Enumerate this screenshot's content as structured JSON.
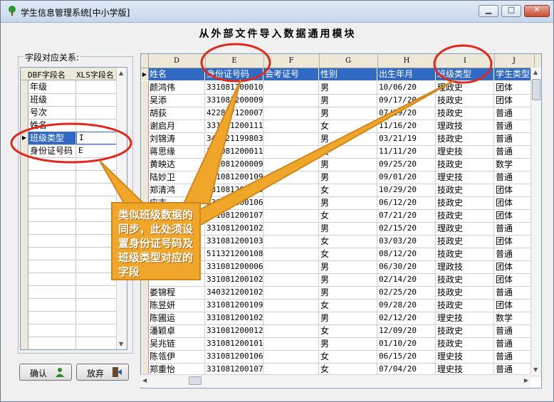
{
  "window": {
    "title": "学生信息管理系统[中小学版]",
    "controls": {
      "minimize": "▁",
      "maximize": "□",
      "close": "✕"
    }
  },
  "heading": "从外部文件导入数据通用模块",
  "mapping_group": {
    "label": "字段对应关系:",
    "columns": [
      "DBF字段名",
      "XLS字段名"
    ],
    "rows": [
      {
        "dbf": "年级",
        "xls": ""
      },
      {
        "dbf": "班级",
        "xls": ""
      },
      {
        "dbf": "号次",
        "xls": ""
      },
      {
        "dbf": "姓名",
        "xls": ""
      },
      {
        "dbf": "班级类型",
        "xls": "I",
        "selected": true
      },
      {
        "dbf": "身份证号码",
        "xls": "E"
      }
    ]
  },
  "buttons": {
    "confirm": "确认",
    "cancel": "放弃"
  },
  "grid": {
    "column_letters": [
      "D",
      "E",
      "F",
      "G",
      "H",
      "I",
      "J"
    ],
    "fields": [
      "姓名",
      "身份证号码",
      "会考证号",
      "性别",
      "出生年月",
      "班级类型",
      "学生类型"
    ],
    "rows": [
      [
        "颜鸿伟",
        "3310812000100",
        "",
        "男",
        "10/06/20",
        "理政史",
        "团体"
      ],
      [
        "吴添",
        "3310812000091",
        "",
        "男",
        "09/17/20",
        "技政史",
        "团体"
      ],
      [
        "胡荻",
        "4228271200072",
        "",
        "男",
        "07/29/20",
        "技政史",
        "普通"
      ],
      [
        "谢启月",
        "3310812001111",
        "",
        "女",
        "11/16/20",
        "理政技",
        "普通"
      ],
      [
        "刘锦涛",
        "3432211998032",
        "",
        "男",
        "03/21/19",
        "技政史",
        "普通"
      ],
      [
        "蒋思缘",
        "3310812000111",
        "",
        "女",
        "11/11/20",
        "理史技",
        "普通"
      ],
      [
        "黄映达",
        "3310812000092",
        "",
        "男",
        "09/25/20",
        "技政史",
        "数学"
      ],
      [
        "陆妙卫",
        "3310812001090",
        "",
        "男",
        "09/01/20",
        "理史技",
        "普通"
      ],
      [
        "郑清鸿",
        "3310812000102",
        "",
        "女",
        "10/29/20",
        "技政史",
        "团体"
      ],
      [
        "应志",
        "3310812001061",
        "",
        "男",
        "06/12/20",
        "技政史",
        "团体"
      ],
      [
        "",
        "3310812001072",
        "",
        "女",
        "07/21/20",
        "技政史",
        "团体"
      ],
      [
        "",
        "3310812001021",
        "",
        "男",
        "02/15/20",
        "理政史",
        "普通"
      ],
      [
        "",
        "3310812001030",
        "",
        "女",
        "03/03/20",
        "技政史",
        "团体"
      ],
      [
        "",
        "5113212001081",
        "",
        "女",
        "08/12/20",
        "技政史",
        "普通"
      ],
      [
        "",
        "3310812000063",
        "",
        "男",
        "06/30/20",
        "理政技",
        "团体"
      ],
      [
        "",
        "3310812001021",
        "",
        "男",
        "02/14/20",
        "技政史",
        "团体"
      ],
      [
        "娄锦程",
        "3403212001022",
        "",
        "男",
        "02/25/20",
        "技政史",
        "普通"
      ],
      [
        "陈昱妍",
        "3310812001092",
        "",
        "女",
        "09/28/20",
        "技政史",
        "团体"
      ],
      [
        "陈圃运",
        "3310812001021",
        "",
        "男",
        "02/12/20",
        "理史技",
        "数学"
      ],
      [
        "潘颖卓",
        "3310812000120",
        "",
        "女",
        "12/09/20",
        "技政史",
        "普通"
      ],
      [
        "吴兆链",
        "3310812001011",
        "",
        "男",
        "01/10/20",
        "技政史",
        "普通"
      ],
      [
        "陈瓴伊",
        "3310812001061",
        "",
        "女",
        "06/15/20",
        "理史技",
        "普通"
      ],
      [
        "郑重怡",
        "3310812001070",
        "",
        "女",
        "07/04/20",
        "理史技",
        "普通"
      ]
    ]
  },
  "callout": "类似班级数据的同步，此处须设置身份证号码及班级类型对应的字段",
  "colors": {
    "selection": "#316ac5",
    "annotation": "#e0281c",
    "callout": "#f0a629"
  }
}
